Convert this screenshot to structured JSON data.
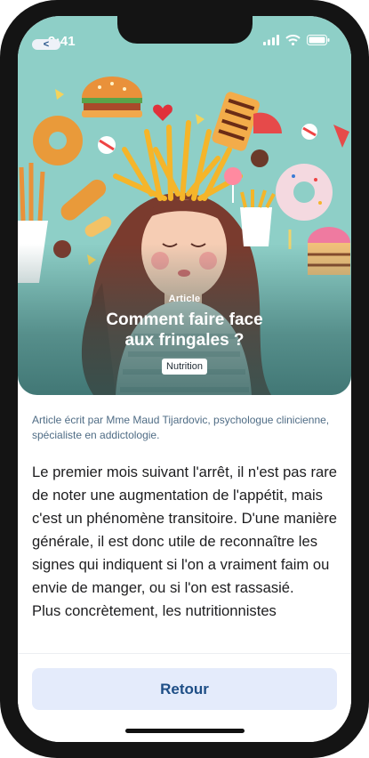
{
  "status_bar": {
    "time": "9:41"
  },
  "nav": {
    "back_label": "<"
  },
  "hero": {
    "kicker": "Article",
    "title": "Comment faire face aux fringales ?",
    "tag": "Nutrition"
  },
  "article": {
    "author": "Article écrit par Mme Maud Tijardovic, psychologue clinicienne, spécialiste en addictologie.",
    "paragraph_1": "Le premier mois suivant l'arrêt, il n'est pas rare de noter une augmentation de l'appétit, mais c'est un phénomène transitoire. D'une manière générale, il est donc utile de reconnaître les signes qui indiquent si l'on a vraiment faim ou envie de manger, ou si l'on est rassasié.",
    "paragraph_2": "Plus concrètement, les nutritionnistes"
  },
  "footer": {
    "button_label": "Retour"
  },
  "colors": {
    "hero_background": "#8ecfc7",
    "button_background": "#e4ebfb",
    "button_text": "#1e4e86",
    "author_text": "#4f6c85"
  }
}
